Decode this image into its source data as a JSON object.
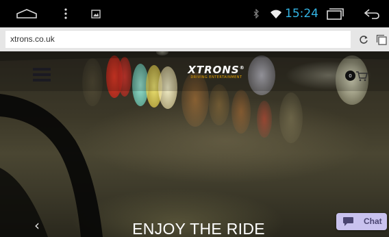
{
  "status_bar": {
    "time": "15:24",
    "icons": [
      "home-icon",
      "overflow-menu-icon",
      "gallery-icon",
      "bluetooth-icon",
      "wifi-icon",
      "recent-apps-icon",
      "back-icon"
    ],
    "time_color": "#33b5e5"
  },
  "browser": {
    "url": "xtrons.co.uk",
    "toolbar_icons": [
      "reload-icon",
      "tabs-icon"
    ]
  },
  "site": {
    "logo_text": "XTRONS",
    "logo_registered": "®",
    "logo_tagline": "DRIVING ENTERTAINMENT",
    "cart_count": "0",
    "hero_title": "ENJOY THE RIDE",
    "slider_prev": "‹",
    "chat_label": "Chat",
    "chat_color": "#c9c2ee",
    "tagline_color": "#e8a400"
  }
}
